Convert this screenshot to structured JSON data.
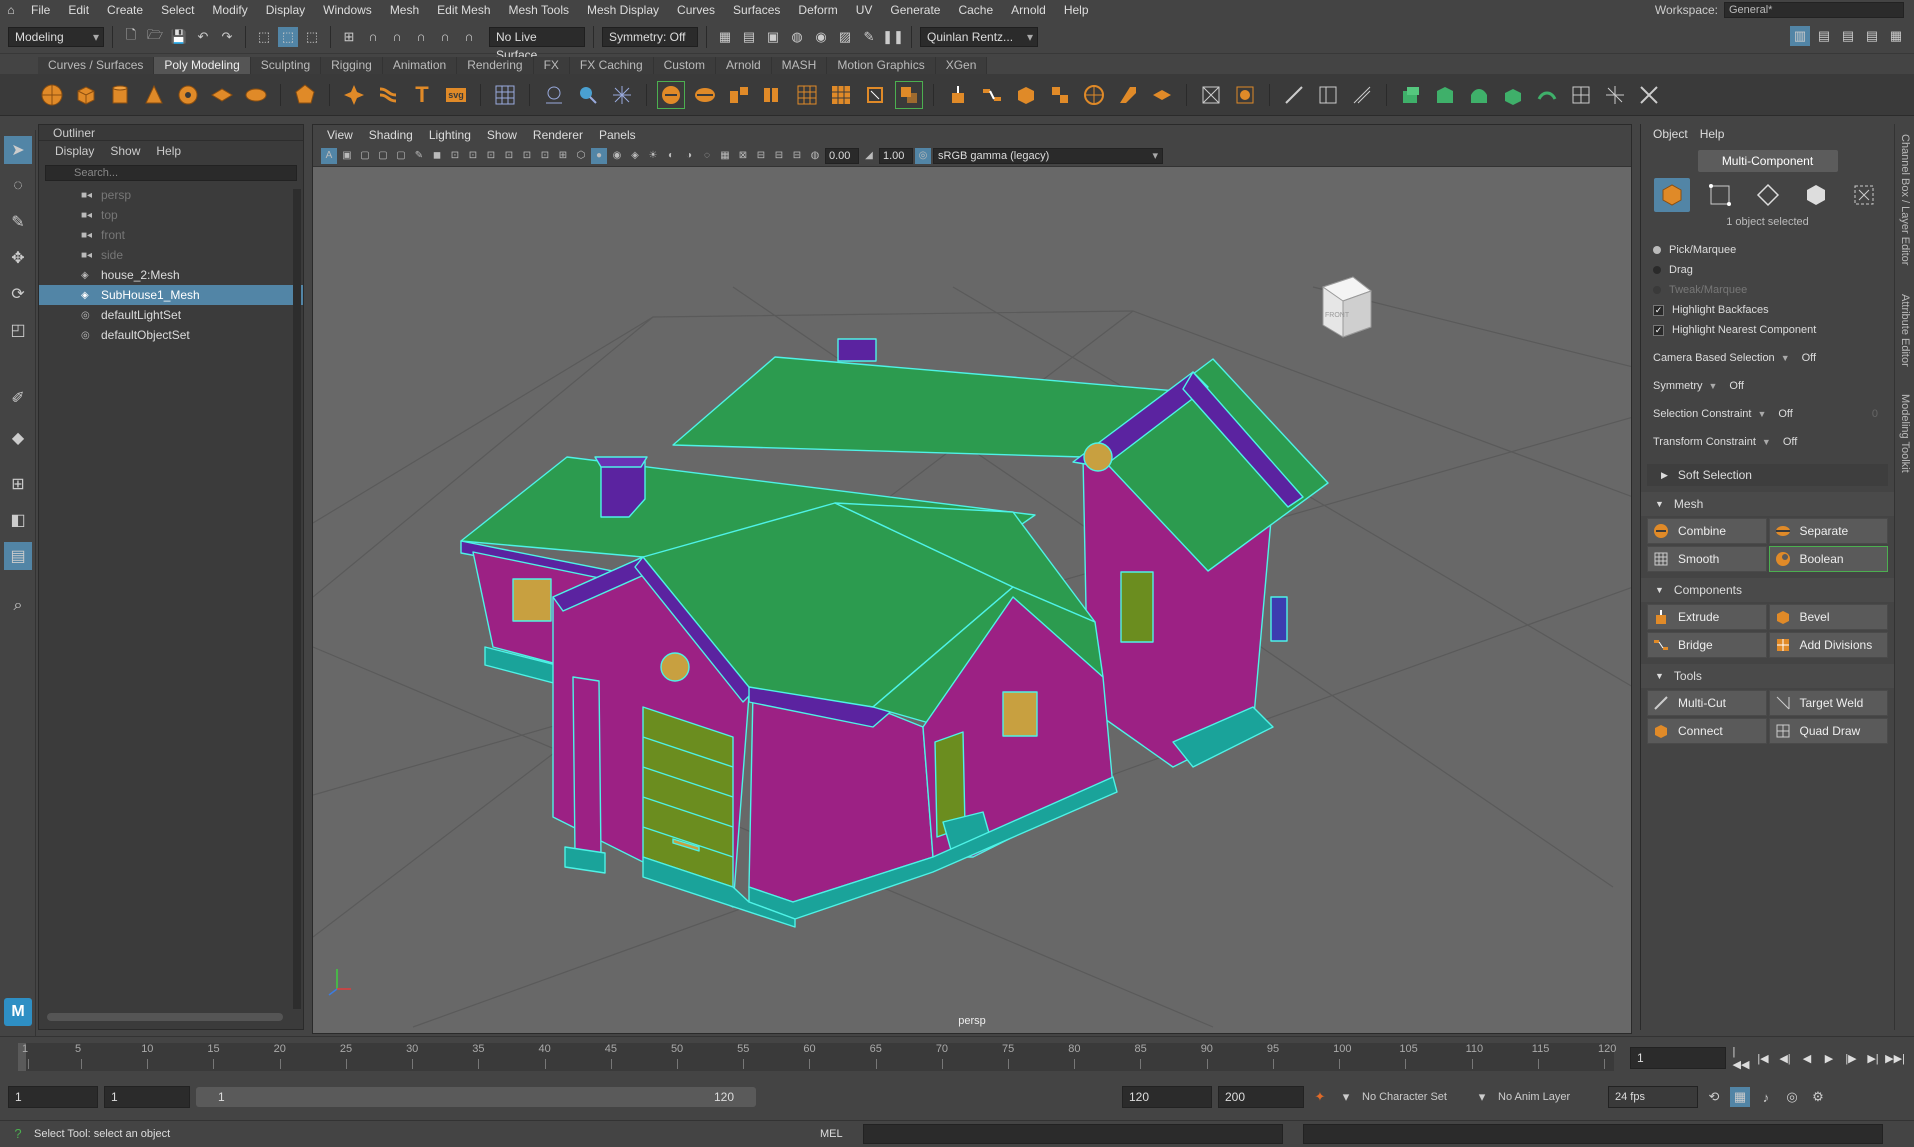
{
  "menubar": {
    "items": [
      "File",
      "Edit",
      "Create",
      "Select",
      "Modify",
      "Display",
      "Windows",
      "Mesh",
      "Edit Mesh",
      "Mesh Tools",
      "Mesh Display",
      "Curves",
      "Surfaces",
      "Deform",
      "UV",
      "Generate",
      "Cache",
      "Arnold",
      "Help"
    ],
    "workspace_label": "Workspace:",
    "workspace_value": "General*"
  },
  "status": {
    "mode": "Modeling",
    "live_surface": "No Live Surface",
    "symmetry": "Symmetry: Off",
    "user": "Quinlan Rentz..."
  },
  "shelf_tabs": [
    "Curves / Surfaces",
    "Poly Modeling",
    "Sculpting",
    "Rigging",
    "Animation",
    "Rendering",
    "FX",
    "FX Caching",
    "Custom",
    "Arnold",
    "MASH",
    "Motion Graphics",
    "XGen"
  ],
  "shelf_active_tab": "Poly Modeling",
  "outliner": {
    "title": "Outliner",
    "menu": [
      "Display",
      "Show",
      "Help"
    ],
    "search_placeholder": "Search...",
    "items": [
      {
        "label": "persp",
        "icon": "camera-icon",
        "dim": true
      },
      {
        "label": "top",
        "icon": "camera-icon",
        "dim": true
      },
      {
        "label": "front",
        "icon": "camera-icon",
        "dim": true
      },
      {
        "label": "side",
        "icon": "camera-icon",
        "dim": true
      },
      {
        "label": "house_2:Mesh",
        "icon": "mesh-icon",
        "dim": false
      },
      {
        "label": "SubHouse1_Mesh",
        "icon": "mesh-icon",
        "selected": true
      },
      {
        "label": "defaultLightSet",
        "icon": "set-icon",
        "dim": false
      },
      {
        "label": "defaultObjectSet",
        "icon": "set-icon",
        "dim": false
      }
    ]
  },
  "viewport": {
    "menu": [
      "View",
      "Shading",
      "Lighting",
      "Show",
      "Renderer",
      "Panels"
    ],
    "exposure": "0.00",
    "gamma": "1.00",
    "color_space": "sRGB gamma (legacy)",
    "camera": "persp",
    "viewcube_label": "FRONT"
  },
  "modeling_toolkit": {
    "menu": [
      "Object",
      "Help"
    ],
    "multi_component": "Multi-Component",
    "selection_count": "1 object selected",
    "pick_marquee": "Pick/Marquee",
    "drag": "Drag",
    "tweak_marquee": "Tweak/Marquee",
    "highlight_backfaces": "Highlight Backfaces",
    "highlight_nearest": "Highlight Nearest Component",
    "camera_based_selection": "Camera Based Selection",
    "camera_based_value": "Off",
    "symmetry": "Symmetry",
    "symmetry_value": "Off",
    "selection_constraint": "Selection Constraint",
    "selection_constraint_value": "Off",
    "selection_constraint_num": "0",
    "transform_constraint": "Transform Constraint",
    "transform_constraint_value": "Off",
    "soft_selection": "Soft Selection",
    "sections": {
      "mesh": {
        "title": "Mesh",
        "buttons": [
          "Combine",
          "Separate",
          "Smooth",
          "Boolean"
        ]
      },
      "components": {
        "title": "Components",
        "buttons": [
          "Extrude",
          "Bevel",
          "Bridge",
          "Add Divisions"
        ]
      },
      "tools": {
        "title": "Tools",
        "buttons": [
          "Multi-Cut",
          "Target Weld",
          "Connect",
          "Quad Draw"
        ]
      }
    }
  },
  "side_tabs": [
    "Channel Box / Layer Editor",
    "Attribute Editor",
    "Modeling Toolkit"
  ],
  "timeline": {
    "ticks": [
      1,
      5,
      10,
      15,
      20,
      25,
      30,
      35,
      40,
      45,
      50,
      55,
      60,
      65,
      70,
      75,
      80,
      85,
      90,
      95,
      100,
      105,
      110,
      115,
      120
    ],
    "current_frame": "1"
  },
  "range": {
    "start": "1",
    "playback_start": "1",
    "slider_start": "1",
    "slider_end": "120",
    "playback_end": "120",
    "end": "200",
    "character_set": "No Character Set",
    "anim_layer": "No Anim Layer",
    "fps": "24 fps"
  },
  "helpline": {
    "message": "Select Tool: select an object",
    "mel_label": "MEL"
  },
  "colors": {
    "selected": "#5285a6",
    "roof": "#2c9b4f",
    "wall": "#9c2184",
    "trim": "#5b23a0",
    "base": "#1aa39a",
    "door": "#6b8d1f",
    "wire": "#4ef2e6"
  }
}
